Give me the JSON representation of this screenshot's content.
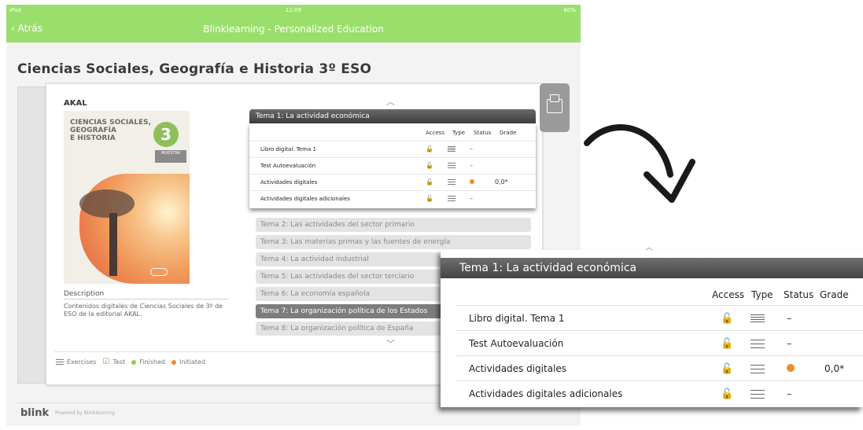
{
  "statusbar": {
    "carrier": "iPad",
    "time": "12:09",
    "battery": "60%"
  },
  "navbar": {
    "back_label": "Atrás",
    "title": "Blinklearning - Personalized Education"
  },
  "page": {
    "title": "Ciencias Sociales, Geografía e Historia 3º ESO"
  },
  "book": {
    "publisher": "AKAL",
    "cover_line1": "CIENCIAS SOCIALES,",
    "cover_line2": "GEOGRAFÍA",
    "cover_line3": "E HISTORIA",
    "cover_number": "3",
    "cover_badge": "MUESTRA",
    "description_label": "Description",
    "description_text": "Contenidos digitales de Ciencias Sociales de 3º de ESO de la editorial AKAL."
  },
  "legend": {
    "exercises": "Exercises",
    "test": "Test",
    "finished": "Finished",
    "initiated": "Initiated"
  },
  "topic_active": {
    "title": "Tema 1: La actividad económica"
  },
  "table_headers": {
    "access": "Access",
    "type": "Type",
    "status": "Status",
    "grade": "Grade"
  },
  "rows": [
    {
      "name": "Libro digital. Tema 1",
      "type_icon": "document-icon",
      "status": "–",
      "grade": ""
    },
    {
      "name": "Test Autoevaluación",
      "type_icon": "list-icon",
      "status": "–",
      "grade": ""
    },
    {
      "name": "Actividades digitales",
      "type_icon": "list-icon",
      "status": "initiated",
      "grade": "0,0*"
    },
    {
      "name": "Actividades digitales adicionales",
      "type_icon": "list-icon",
      "status": "–",
      "grade": ""
    }
  ],
  "topics": [
    {
      "label": "Tema 2: Las actividades del sector primario",
      "selected": false
    },
    {
      "label": "Tema 3: Las materias primas y las fuentes de energía",
      "selected": false
    },
    {
      "label": "Tema 4: La actividad industrial",
      "selected": false
    },
    {
      "label": "Tema 5: Las actividades del sector terciario",
      "selected": false
    },
    {
      "label": "Tema 6: La economía española",
      "selected": false
    },
    {
      "label": "Tema 7: La organización política de los Estados",
      "selected": true
    },
    {
      "label": "Tema 8: La organización política de España",
      "selected": false
    }
  ],
  "footer": {
    "logo": "blink",
    "powered": "Powered by Blinklearning"
  },
  "colors": {
    "brand_green": "#9adf6c",
    "finished": "#8fd04a",
    "initiated": "#f28a2b"
  }
}
